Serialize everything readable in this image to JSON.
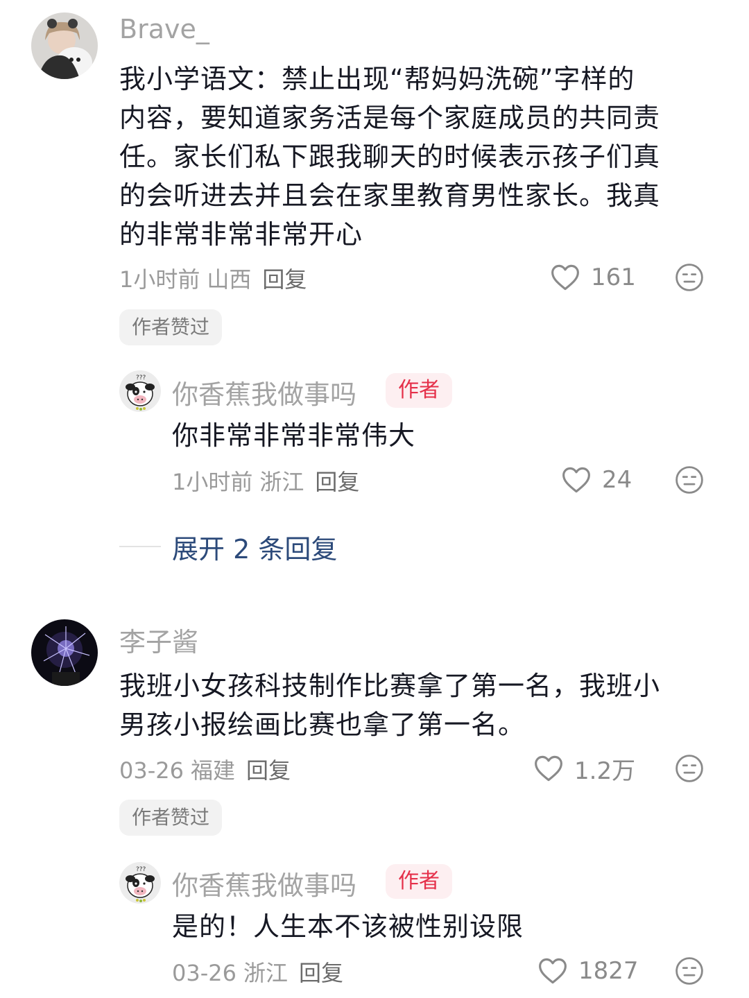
{
  "comments": [
    {
      "username": "Brave_",
      "lines": [
        "我小学语文：禁止出现“帮妈妈洗碗”字样的",
        "内容，要知道家务活是每个家庭成员的共同责",
        "任。家长们私下跟我聊天的时候表示孩子们真",
        "的会听进去并且会在家里教育男性家长。我真",
        "的非常非常非常开心"
      ],
      "time": "1小时前",
      "location": "山西",
      "reply_label": "回复",
      "likes": "161",
      "author_liked": "作者赞过",
      "reply": {
        "username": "你香蕉我做事吗",
        "author_tag": "作者",
        "text": "你非常非常非常伟大",
        "time": "1小时前",
        "location": "浙江",
        "reply_label": "回复",
        "likes": "24"
      },
      "expand_label": "展开 2 条回复"
    },
    {
      "username": "李子酱",
      "lines": [
        "我班小女孩科技制作比赛拿了第一名，我班小",
        "男孩小报绘画比赛也拿了第一名。"
      ],
      "time": "03-26",
      "location": "福建",
      "reply_label": "回复",
      "likes": "1.2万",
      "author_liked": "作者赞过",
      "reply": {
        "username": "你香蕉我做事吗",
        "author_tag": "作者",
        "text": "是的！人生本不该被性别设限",
        "time": "03-26",
        "location": "浙江",
        "reply_label": "回复",
        "likes": "1827"
      }
    }
  ],
  "colors": {
    "text": "#161823",
    "muted": "#a3a3a3",
    "author_tag": "#e5304a",
    "expand": "#2c4a7a"
  },
  "icons": {
    "like": "heart-outline-icon",
    "dislike": "neutral-face-icon"
  }
}
